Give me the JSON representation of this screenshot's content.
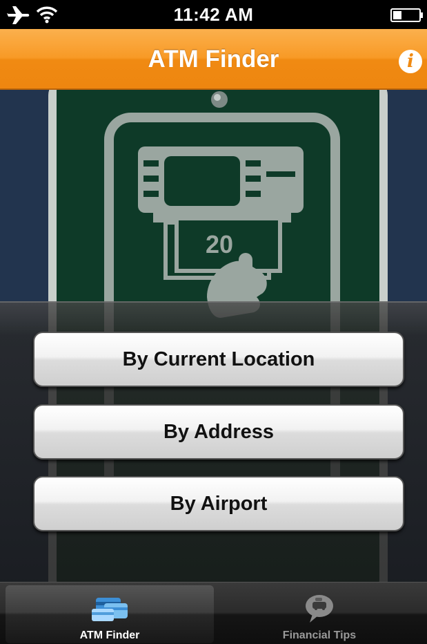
{
  "status_bar": {
    "time": "11:42 AM",
    "icons": [
      "airplane-icon",
      "wifi-icon",
      "battery-icon"
    ]
  },
  "nav_bar": {
    "title": "ATM Finder",
    "info_icon": "info-icon",
    "info_glyph": "i"
  },
  "hero": {
    "image": "atm-sign",
    "banknote_text": "20"
  },
  "menu": {
    "buttons": [
      {
        "label": "By Current Location"
      },
      {
        "label": "By Address"
      },
      {
        "label": "By Airport"
      }
    ]
  },
  "tab_bar": {
    "tabs": [
      {
        "label": "ATM Finder",
        "icon": "atm-card-icon",
        "selected": true
      },
      {
        "label": "Financial Tips",
        "icon": "piggy-bank-icon",
        "selected": false
      }
    ]
  },
  "colors": {
    "nav_orange": "#f89a26",
    "sign_green": "#0e3a28",
    "sign_gray": "#9aa6a0"
  }
}
